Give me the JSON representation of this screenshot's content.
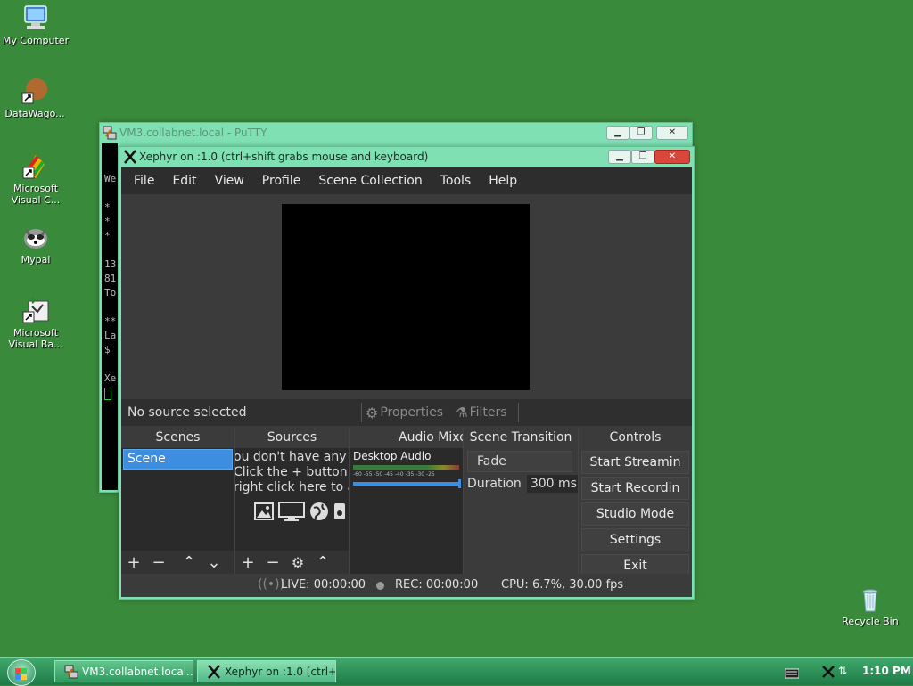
{
  "desktop": {
    "icons": [
      {
        "label": "My Computer"
      },
      {
        "label": "DataWago..."
      },
      {
        "label": "Microsoft Visual C..."
      },
      {
        "label": "Mypal"
      },
      {
        "label": "Microsoft Visual Ba..."
      },
      {
        "label": "Recycle Bin"
      }
    ]
  },
  "putty": {
    "title": "VM3.collabnet.local - PuTTY",
    "terminal_lines": [
      "",
      "",
      "We",
      "",
      "*",
      "*",
      "*",
      "",
      "13",
      "81",
      "To",
      "",
      "**",
      "La",
      "$",
      "",
      "Xe"
    ]
  },
  "xephyr": {
    "title": "Xephyr on :1.0 (ctrl+shift grabs mouse and keyboard)"
  },
  "obs": {
    "menu": [
      "File",
      "Edit",
      "View",
      "Profile",
      "Scene Collection",
      "Tools",
      "Help"
    ],
    "source_bar": {
      "status": "No source selected",
      "properties": "Properties",
      "filters": "Filters"
    },
    "docks": {
      "scenes": {
        "header": "Scenes",
        "items": [
          "Scene"
        ]
      },
      "sources": {
        "header": "Sources",
        "empty_lines": [
          "ou don't have any so",
          "Click the + button b",
          "right click here to a"
        ]
      },
      "audio": {
        "header": "Audio Mixe",
        "track": "Desktop Audio",
        "scale": "-60 -55 -50 -45 -40 -35 -30 -25"
      },
      "transition": {
        "header": "Scene Transition",
        "type": "Fade",
        "duration_label": "Duration",
        "duration_value": "300 ms"
      },
      "controls": {
        "header": "Controls",
        "buttons": [
          "Start Streamin",
          "Start Recordin",
          "Studio Mode",
          "Settings",
          "Exit"
        ]
      }
    },
    "status": {
      "live": "LIVE: 00:00:00",
      "rec": "REC: 00:00:00",
      "cpu": "CPU: 6.7%, 30.00 fps"
    }
  },
  "taskbar": {
    "tasks": [
      "VM3.collabnet.local...",
      "Xephyr on :1.0 [ctrl+..."
    ],
    "clock": "1:10 PM"
  }
}
